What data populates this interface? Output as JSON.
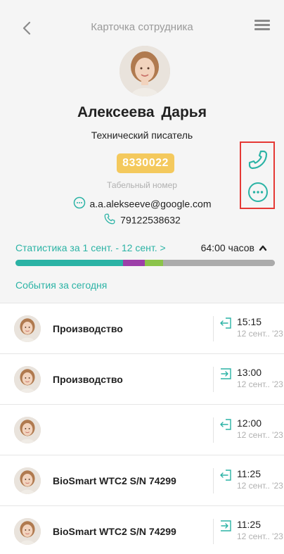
{
  "header": {
    "title": "Карточка сотрудника"
  },
  "employee": {
    "name": "Алексеева  Дарья",
    "position": "Технический писатель",
    "badge_number": "8330022",
    "badge_label": "Табельный номер",
    "email": "a.a.alekseeve@google.com",
    "phone": "79122538632"
  },
  "stats": {
    "period_label": "Статистика за 1 сент. - 12 сент. >",
    "hours_label": "64:00 часов",
    "bar_segments": [
      {
        "color": "#2bb3a5",
        "fraction": 0.415
      },
      {
        "color": "#9c3fa8",
        "fraction": 0.085
      },
      {
        "color": "#8bc34a",
        "fraction": 0.07
      },
      {
        "color": "#ababab",
        "fraction": 0.43
      }
    ]
  },
  "events": {
    "title": "События за сегодня",
    "items": [
      {
        "name": "Производство",
        "direction": "out",
        "time": "15:15",
        "date": "12 сент.. '23"
      },
      {
        "name": "Производство",
        "direction": "in",
        "time": "13:00",
        "date": "12 сент.. '23"
      },
      {
        "name": "",
        "direction": "out",
        "time": "12:00",
        "date": "12 сент.. '23"
      },
      {
        "name": "BioSmart WTC2 S/N 74299",
        "direction": "out",
        "time": "11:25",
        "date": "12 сент.. '23"
      },
      {
        "name": "BioSmart WTC2 S/N 74299",
        "direction": "in",
        "time": "11:25",
        "date": "12 сент.. '23"
      }
    ]
  },
  "colors": {
    "accent": "#2bb3a5",
    "badge": "#f4c95d",
    "highlight_box": "#e53935"
  }
}
